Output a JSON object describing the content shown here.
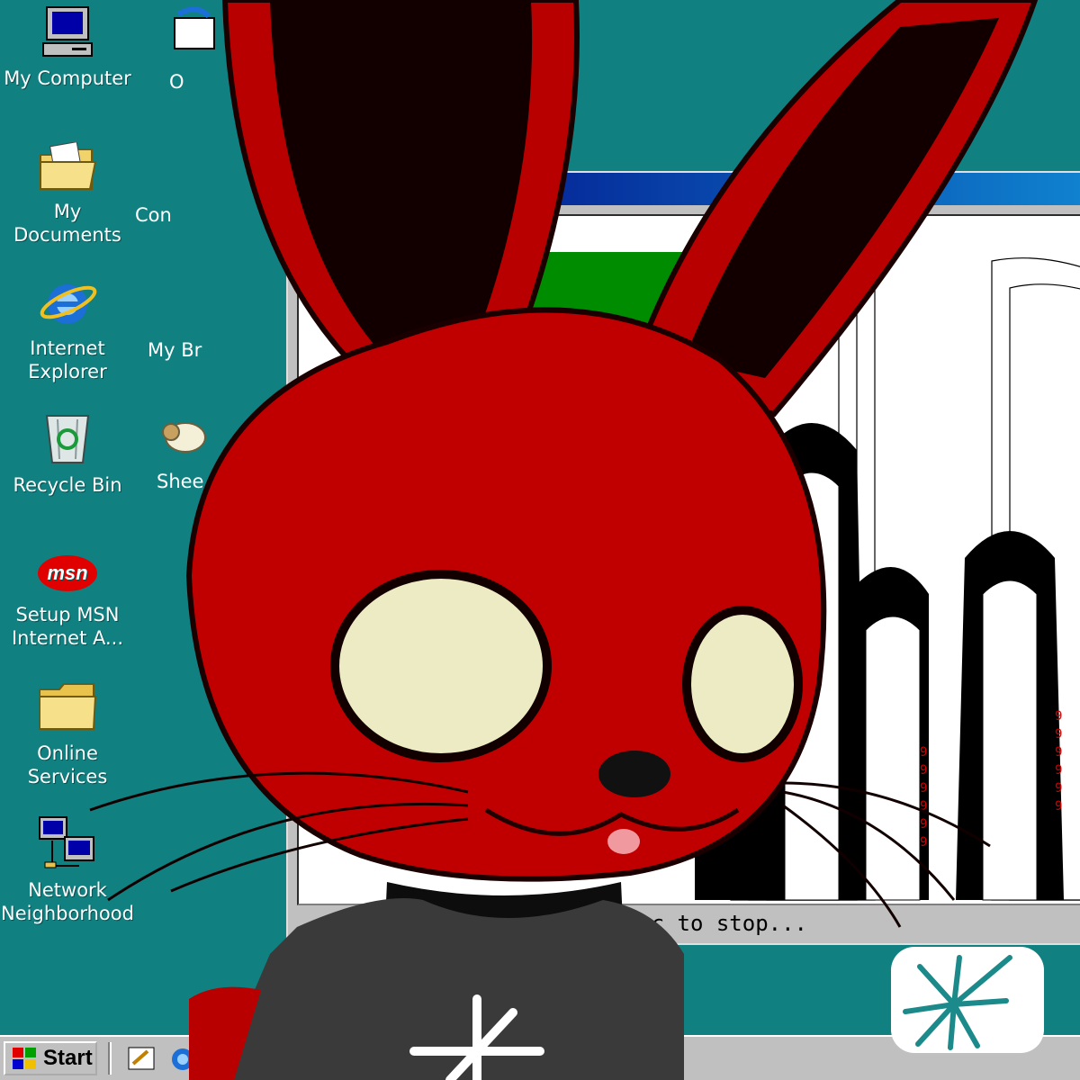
{
  "desktop": {
    "background_color": "#108080",
    "icons": [
      {
        "label": "My Computer",
        "icon": "my-computer-icon"
      },
      {
        "label": "My Documents",
        "icon": "my-documents-icon"
      },
      {
        "label": "Internet\nExplorer",
        "icon": "internet-explorer-icon"
      },
      {
        "label": "Recycle Bin",
        "icon": "recycle-bin-icon"
      },
      {
        "label": "Setup MSN\nInternet A...",
        "icon": "msn-icon"
      },
      {
        "label": "Online\nServices",
        "icon": "folder-icon"
      },
      {
        "label": "Network\nNeighborhood",
        "icon": "network-neighborhood-icon"
      }
    ],
    "icons_col2": [
      {
        "label": "O",
        "icon": "outlook-express-icon"
      },
      {
        "label": "Con",
        "icon": "connect-icon"
      },
      {
        "label": "My Br",
        "icon": "my-briefcase-icon"
      },
      {
        "label": "Shee",
        "icon": "sheep-icon"
      }
    ]
  },
  "window": {
    "status_text": "press Esc to stop..."
  },
  "taskbar": {
    "start_label": "Start"
  }
}
